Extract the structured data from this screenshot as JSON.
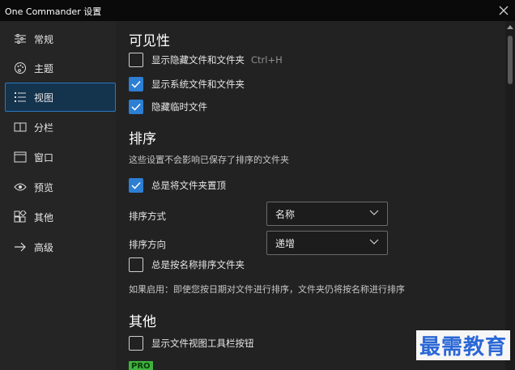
{
  "window": {
    "title": "One Commander 设置"
  },
  "sidebar": {
    "items": [
      {
        "label": "常规",
        "icon": "sliders-icon"
      },
      {
        "label": "主题",
        "icon": "palette-icon"
      },
      {
        "label": "视图",
        "icon": "list-view-icon",
        "active": true
      },
      {
        "label": "分栏",
        "icon": "columns-icon"
      },
      {
        "label": "窗口",
        "icon": "window-icon"
      },
      {
        "label": "预览",
        "icon": "eye-icon"
      },
      {
        "label": "其他",
        "icon": "apps-icon"
      },
      {
        "label": "高级",
        "icon": "arrow-right-icon"
      }
    ]
  },
  "visibility": {
    "heading": "可见性",
    "show_hidden": {
      "label": "显示隐藏文件和文件夹",
      "shortcut": "Ctrl+H",
      "checked": false
    },
    "show_system": {
      "label": "显示系统文件和文件夹",
      "checked": true
    },
    "hide_temp": {
      "label": "隐藏临时文件",
      "checked": true
    }
  },
  "sorting": {
    "heading": "排序",
    "description": "这些设置不会影响已保存了排序的文件夹",
    "folders_top": {
      "label": "总是将文件夹置顶",
      "checked": true
    },
    "sort_by": {
      "label": "排序方式",
      "value": "名称"
    },
    "sort_dir": {
      "label": "排序方向",
      "value": "递增"
    },
    "folders_by_name": {
      "label": "总是按名称排序文件夹",
      "checked": false
    },
    "note": "如果启用：即使您按日期对文件进行排序，文件夹仍将按名称进行排序"
  },
  "other": {
    "heading": "其他",
    "show_toolbar": {
      "label": "显示文件视图工具栏按钮",
      "checked": false
    },
    "pro_badge": "PRO"
  },
  "watermark": "最需教育",
  "colors": {
    "accent": "#2d7fd3",
    "sidebar_active": "#14334d",
    "pro": "#3db33d"
  }
}
